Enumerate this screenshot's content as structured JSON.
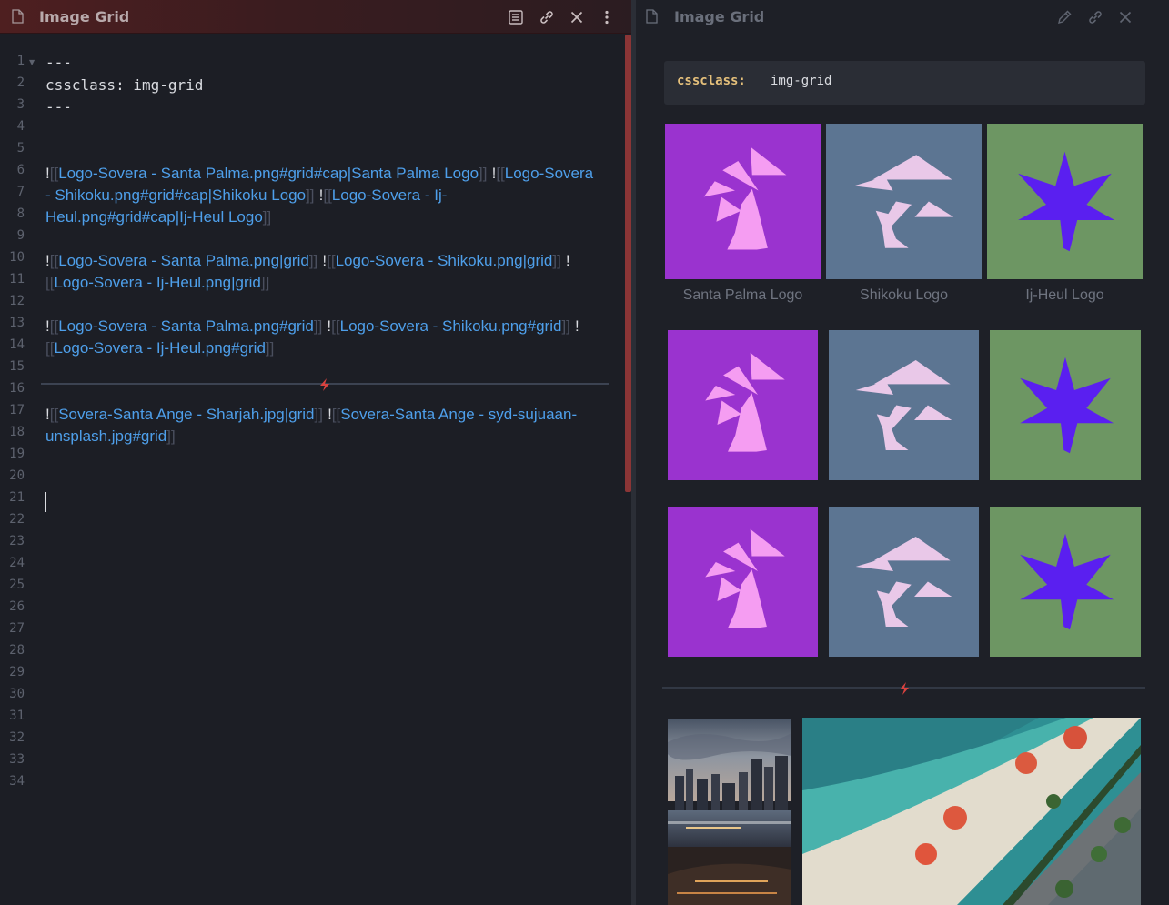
{
  "left": {
    "title": "Image Grid",
    "header_actions": [
      "reading-view-icon",
      "link-icon",
      "close-icon",
      "more-options-icon"
    ],
    "line_numbers": [
      "1",
      "2",
      "3",
      "4",
      "5",
      "6",
      "7",
      "8",
      "9",
      "10",
      "11",
      "12",
      "13",
      "14",
      "15",
      "16",
      "17",
      "18",
      "19",
      "20",
      "21",
      "22",
      "23",
      "24",
      "25",
      "26",
      "27",
      "28",
      "29",
      "30",
      "31",
      "32",
      "33",
      "34"
    ],
    "frontmatter": {
      "dashes": "---",
      "key": "cssclass:",
      "value": "img-grid"
    },
    "lines": {
      "l6a": {
        "link1": "Logo-Sovera - Santa Palma.png#grid#cap|Santa Palma Logo",
        "link2": "Logo-Sovera"
      },
      "l6b": {
        "link2cont": "- Shikoku.png#grid#cap|Shikoku Logo",
        "link3": "Logo-Sovera - Ij-"
      },
      "l6c": {
        "link3cont": "Heul.png#grid#cap|Ij-Heul Logo"
      },
      "l8a": {
        "link1": "Logo-Sovera - Santa Palma.png|grid",
        "link2": "Logo-Sovera - Shikoku.png|grid"
      },
      "l8b": {
        "link3": "Logo-Sovera - Ij-Heul.png|grid"
      },
      "l10a": {
        "link1": "Logo-Sovera - Santa Palma.png#grid",
        "link2": "Logo-Sovera - Shikoku.png#grid"
      },
      "l10b": {
        "link3": "Logo-Sovera - Ij-Heul.png#grid"
      },
      "l13a": {
        "link1": "Sovera-Santa Ange - Sharjah.jpg|grid",
        "link2": "Sovera-Santa Ange - syd-sujuaan-"
      },
      "l13b": {
        "link2cont": "unsplash.jpg#grid"
      }
    },
    "syntax": {
      "bang": "!",
      "open": "[[",
      "close": "]]"
    }
  },
  "right": {
    "title": "Image Grid",
    "header_actions": [
      "edit-icon",
      "link-icon",
      "close-icon"
    ],
    "frontmatter": {
      "key": "cssclass:",
      "value": "img-grid"
    },
    "captions": [
      "Santa Palma Logo",
      "Shikoku Logo",
      "Ij-Heul Logo"
    ],
    "photos": [
      "Sovera-Santa Ange - Sharjah.jpg",
      "Sovera-Santa Ange - syd-sujuaan-unsplash.jpg"
    ]
  },
  "colors": {
    "palma_bg": "#9a33cf",
    "palma_fg": "#f59df2",
    "shikoku_bg": "#5c7592",
    "shikoku_fg": "#e9c8e8",
    "heul_bg": "#6d9663",
    "heul_fg": "#5a1ff0",
    "link": "#4e9fea",
    "accent_red": "#d9423f"
  }
}
